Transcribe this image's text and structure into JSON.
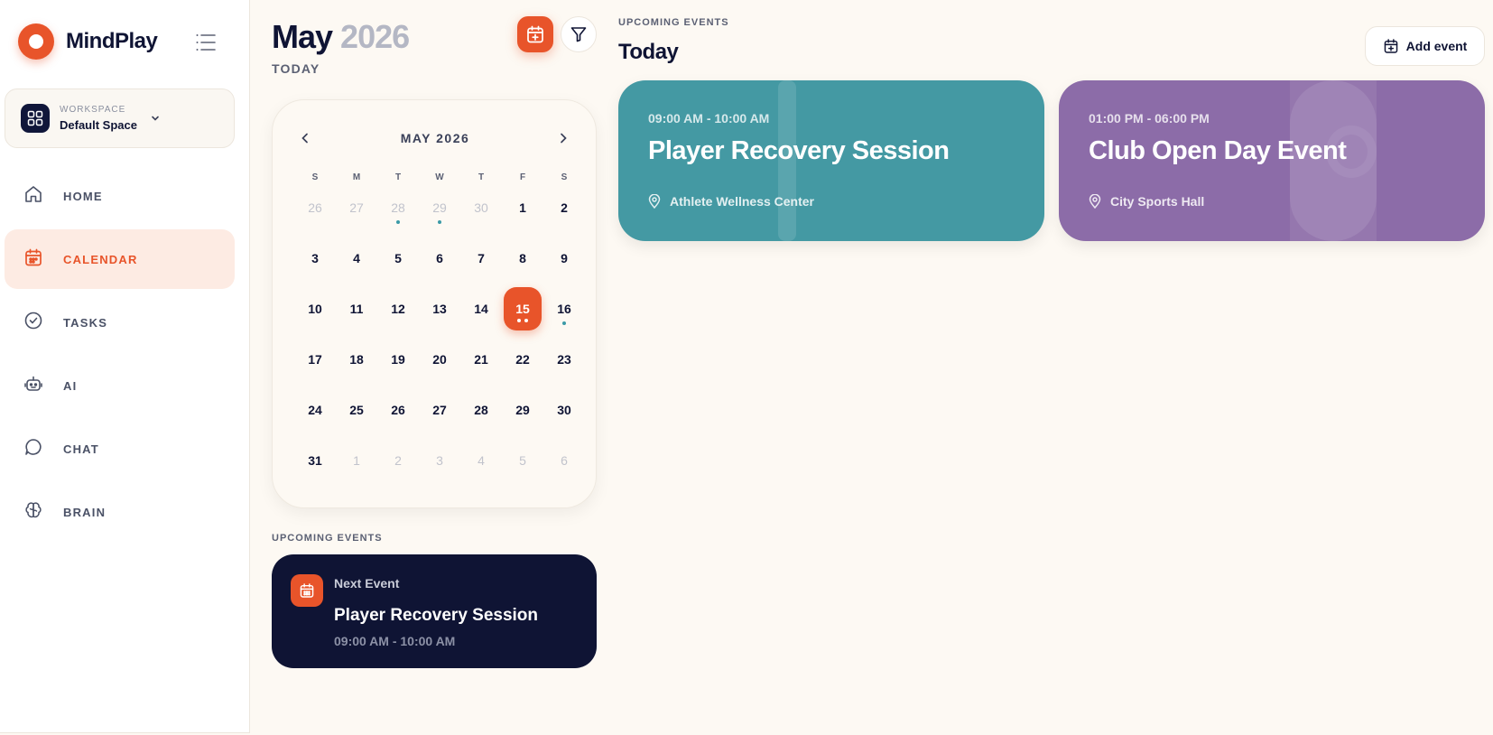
{
  "app": {
    "name": "MindPlay"
  },
  "workspace": {
    "label": "WORKSPACE",
    "value": "Default Space"
  },
  "nav": {
    "items": [
      {
        "label": "HOME",
        "icon": "home-icon"
      },
      {
        "label": "CALENDAR",
        "icon": "calendar-icon",
        "active": true
      },
      {
        "label": "TASKS",
        "icon": "check-circle-icon"
      },
      {
        "label": "AI",
        "icon": "robot-icon"
      },
      {
        "label": "CHAT",
        "icon": "chat-icon"
      },
      {
        "label": "BRAIN",
        "icon": "brain-icon"
      }
    ]
  },
  "calendar": {
    "month": "May",
    "year": "2026",
    "today_label": "TODAY",
    "card_title": "MAY 2026",
    "weekdays": [
      "S",
      "M",
      "T",
      "W",
      "T",
      "F",
      "S"
    ],
    "selected_day": "15",
    "days": [
      {
        "d": "26",
        "muted": true
      },
      {
        "d": "27",
        "muted": true
      },
      {
        "d": "28",
        "muted": true,
        "dot": true
      },
      {
        "d": "29",
        "muted": true,
        "dot": true
      },
      {
        "d": "30",
        "muted": true
      },
      {
        "d": "1"
      },
      {
        "d": "2"
      },
      {
        "d": "3"
      },
      {
        "d": "4"
      },
      {
        "d": "5"
      },
      {
        "d": "6"
      },
      {
        "d": "7"
      },
      {
        "d": "8"
      },
      {
        "d": "9"
      },
      {
        "d": "10"
      },
      {
        "d": "11"
      },
      {
        "d": "12"
      },
      {
        "d": "13"
      },
      {
        "d": "14"
      },
      {
        "d": "15",
        "today": true,
        "dots": 2
      },
      {
        "d": "16",
        "dot": true
      },
      {
        "d": "17"
      },
      {
        "d": "18"
      },
      {
        "d": "19"
      },
      {
        "d": "20"
      },
      {
        "d": "21"
      },
      {
        "d": "22"
      },
      {
        "d": "23"
      },
      {
        "d": "24"
      },
      {
        "d": "25"
      },
      {
        "d": "26"
      },
      {
        "d": "27"
      },
      {
        "d": "28"
      },
      {
        "d": "29"
      },
      {
        "d": "30"
      },
      {
        "d": "31"
      },
      {
        "d": "1",
        "muted": true
      },
      {
        "d": "2",
        "muted": true
      },
      {
        "d": "3",
        "muted": true
      },
      {
        "d": "4",
        "muted": true
      },
      {
        "d": "5",
        "muted": true
      },
      {
        "d": "6",
        "muted": true
      }
    ]
  },
  "next_event": {
    "section_label": "UPCOMING EVENTS",
    "kicker": "Next Event",
    "title": "Player Recovery Session",
    "time": "09:00 AM - 10:00 AM"
  },
  "upcoming": {
    "section_label": "UPCOMING EVENTS",
    "title": "Today",
    "add_label": "Add event",
    "events": [
      {
        "time": "09:00 AM - 10:00 AM",
        "title": "Player Recovery Session",
        "location": "Athlete Wellness Center",
        "color": "#4499a3"
      },
      {
        "time": "01:00 PM - 06:00 PM",
        "title": "Club Open Day Event",
        "location": "City Sports Hall",
        "color": "#8c6ca8"
      }
    ]
  },
  "colors": {
    "accent": "#e8542a",
    "navy": "#0f1434",
    "event_dot": "#3b9aa7"
  }
}
